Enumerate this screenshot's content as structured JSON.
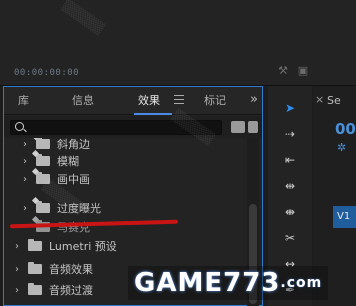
{
  "monitor": {
    "timecode": "00:00:00:00"
  },
  "panel": {
    "tabs": [
      {
        "label": "库"
      },
      {
        "label": "信息"
      },
      {
        "label": "效果"
      },
      {
        "label": "标记"
      }
    ],
    "more": "»",
    "search": {
      "value": "",
      "placeholder": ""
    },
    "items": [
      {
        "label": "斜角边",
        "chevron": "›"
      },
      {
        "label": "模糊",
        "chevron": "›"
      },
      {
        "label": "画中画",
        "chevron": "›"
      },
      {
        "label": "过度曝光",
        "chevron": "›"
      },
      {
        "label": "马赛克",
        "chevron": ""
      },
      {
        "label": "Lumetri 预设",
        "chevron": "›"
      },
      {
        "label": "音频效果",
        "chevron": "›"
      },
      {
        "label": "音频过渡",
        "chevron": "›"
      }
    ]
  },
  "timeline": {
    "tab": "Se",
    "close": "×",
    "timecode": "00",
    "track": "V1"
  },
  "watermark": {
    "logo": "GAME773",
    "suffix": ".com"
  },
  "colors": {
    "accent": "#2e7bcf",
    "annotation": "#c81414"
  }
}
